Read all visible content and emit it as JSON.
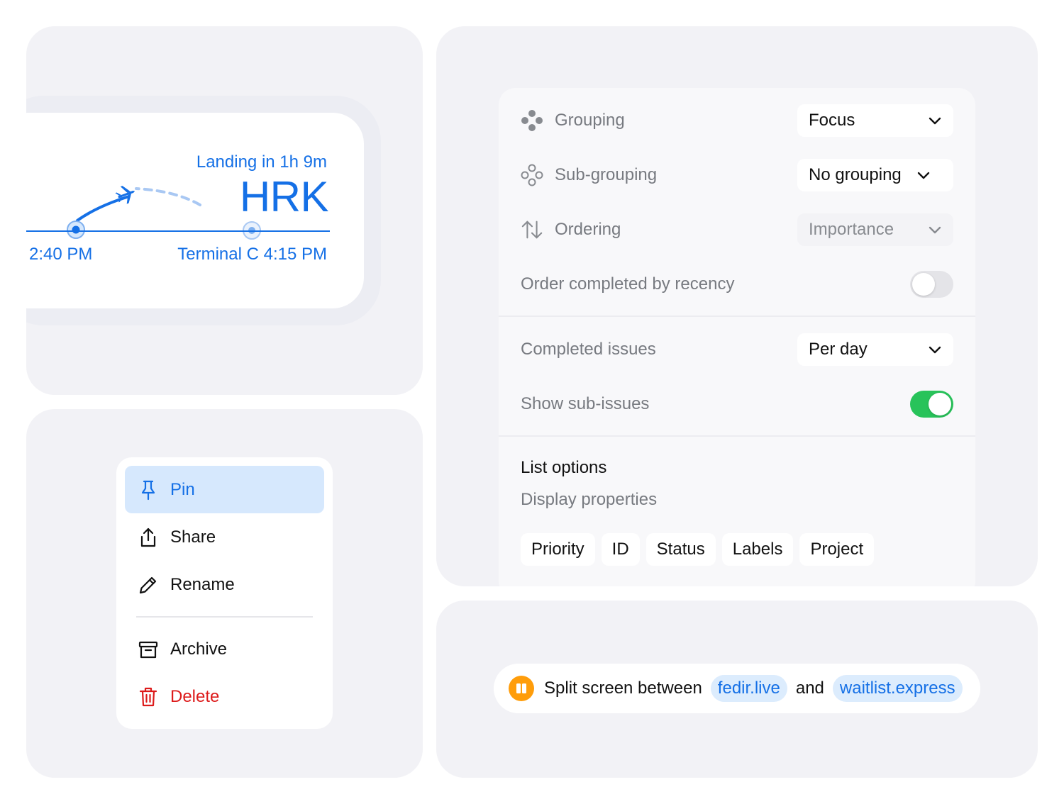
{
  "flight": {
    "landing_text": "Landing in 1h 9m",
    "destination_code": "HRK",
    "departure_time": "2:40 PM",
    "arrival_info": "Terminal C 4:15 PM",
    "accent_color": "#1570e6"
  },
  "context_menu": {
    "items": [
      {
        "label": "Pin",
        "icon": "pin-icon",
        "active": true
      },
      {
        "label": "Share",
        "icon": "share-icon"
      },
      {
        "label": "Rename",
        "icon": "pencil-icon"
      },
      {
        "label": "Archive",
        "icon": "archive-icon"
      },
      {
        "label": "Delete",
        "icon": "trash-icon",
        "danger": true
      }
    ],
    "active_color": "#d6e8fd",
    "danger_color": "#dd1b1b"
  },
  "view_options": {
    "grouping": {
      "label": "Grouping",
      "value": "Focus",
      "icon": "grouping-icon"
    },
    "sub_grouping": {
      "label": "Sub-grouping",
      "value": "No grouping",
      "icon": "sub-grouping-icon"
    },
    "ordering": {
      "label": "Ordering",
      "value": "Importance",
      "icon": "sort-arrows-icon"
    },
    "order_completed": {
      "label": "Order completed by recency",
      "enabled": false
    },
    "completed_issues": {
      "label": "Completed issues",
      "value": "Per day"
    },
    "show_sub_issues": {
      "label": "Show sub-issues",
      "enabled": true
    },
    "list_options_title": "List options",
    "display_properties_label": "Display properties",
    "properties": [
      "Priority",
      "ID",
      "Status",
      "Labels",
      "Project"
    ],
    "toggle_on_color": "#28c35a"
  },
  "split_screen": {
    "text": "Split screen between",
    "site_one": "fedir.live",
    "connector": "and",
    "site_two": "waitlist.express",
    "icon": "split-screen-icon",
    "icon_color": "#ff9d0a"
  }
}
